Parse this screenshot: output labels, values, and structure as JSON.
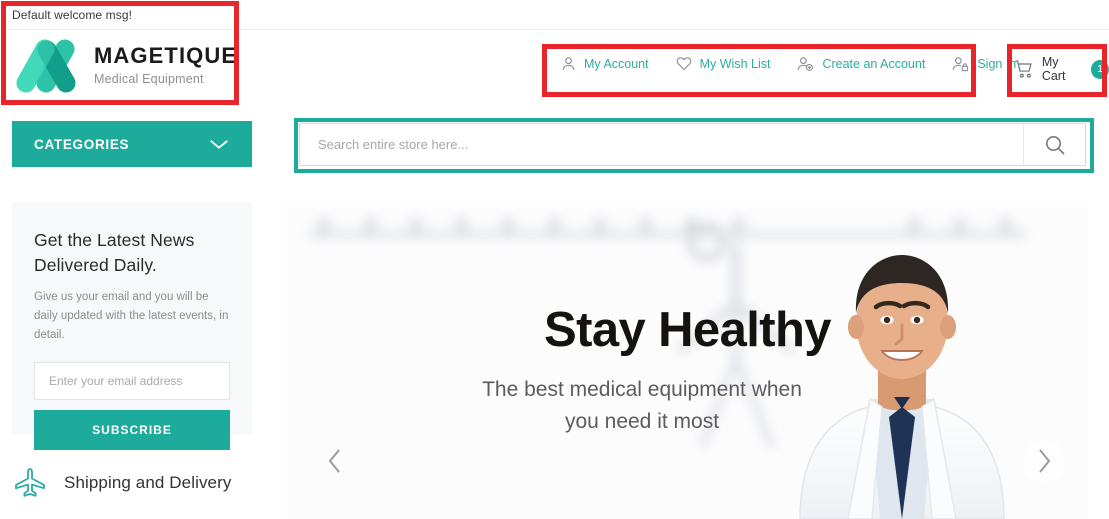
{
  "welcome": {
    "message": "Default welcome msg!"
  },
  "brand": {
    "name": "MAGETIQUE",
    "tagline": "Medical Equipment",
    "logo_icon": "magetique-m-logo",
    "colors": {
      "teal_light": "#3fd6b8",
      "teal_mid": "#2cc3a8",
      "teal_dark": "#139e8c"
    }
  },
  "account_nav": {
    "items": [
      {
        "label": "My Account",
        "icon": "user-icon"
      },
      {
        "label": "My Wish List",
        "icon": "heart-icon"
      },
      {
        "label": "Create an Account",
        "icon": "user-plus-icon"
      },
      {
        "label": "Sign In",
        "icon": "user-lock-icon"
      }
    ]
  },
  "cart": {
    "label": "My Cart",
    "count": "1",
    "icon": "shopping-cart-icon",
    "badge_color": "#1dab9c"
  },
  "categories": {
    "label": "CATEGORIES",
    "icon": "chevron-down-icon",
    "color": "#1dab9c"
  },
  "search": {
    "placeholder": "Search entire store here...",
    "value": "",
    "button_icon": "search-icon"
  },
  "newsletter": {
    "title_line1": "Get the Latest News",
    "title_line2": "Delivered Daily.",
    "description": "Give us your email and you will be daily updated with the latest events, in detail.",
    "input_placeholder": "Enter your email address",
    "input_value": "",
    "button_label": "SUBSCRIBE"
  },
  "shipping": {
    "label": "Shipping and Delivery",
    "icon": "airplane-icon",
    "icon_color": "#2aada0"
  },
  "hero": {
    "heading": "Stay Healthy",
    "subtitle_line1": "The best medical equipment when",
    "subtitle_line2": "you need it most",
    "prev_icon": "chevron-left-icon",
    "next_icon": "chevron-right-icon"
  },
  "annotations": {
    "red_color": "#e8252a",
    "teal_color": "#1dab9c",
    "boxes": [
      {
        "name": "logo-highlight",
        "style": "red"
      },
      {
        "name": "account-highlight",
        "style": "red"
      },
      {
        "name": "cart-highlight",
        "style": "red"
      },
      {
        "name": "search-highlight",
        "style": "teal"
      }
    ]
  }
}
